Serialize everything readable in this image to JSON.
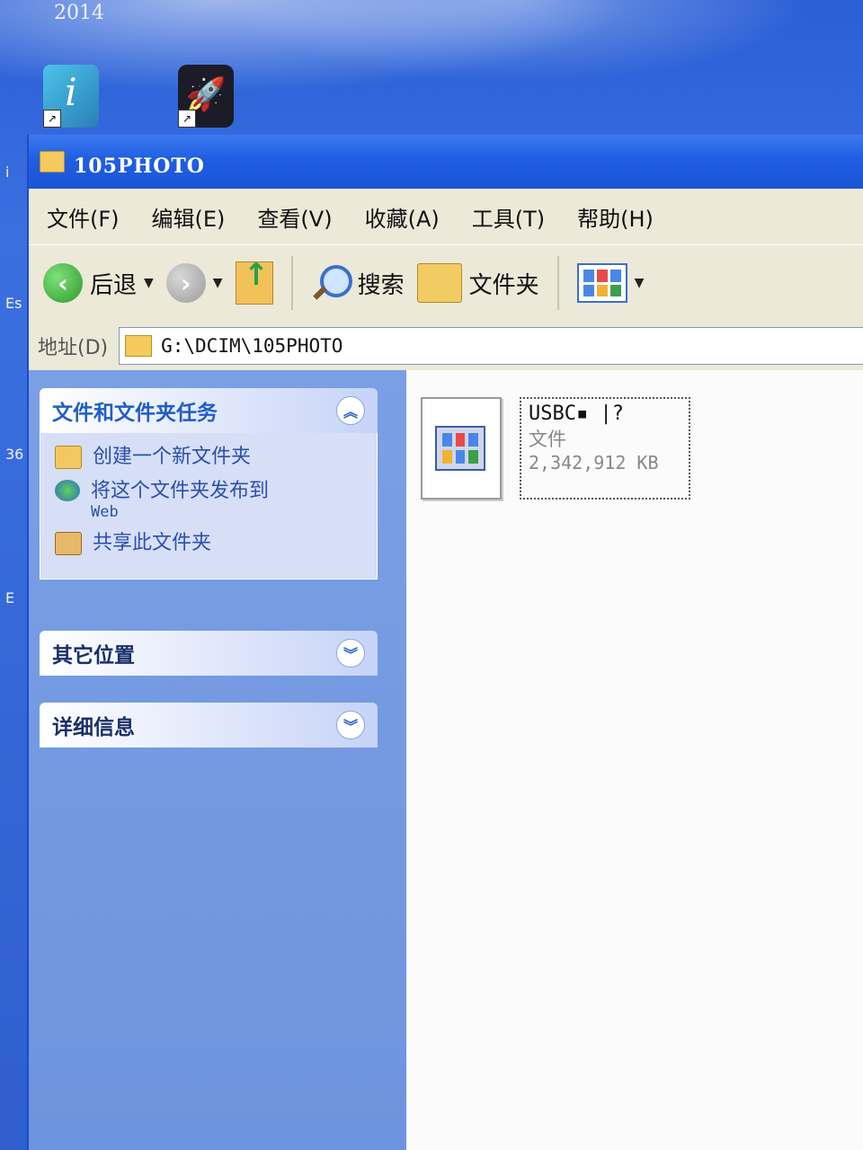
{
  "desktop": {
    "year": "2014",
    "edge_letters": [
      "i",
      "Es",
      "36",
      "E"
    ]
  },
  "window": {
    "title": "105PHOTO",
    "menu": [
      "文件(F)",
      "编辑(E)",
      "查看(V)",
      "收藏(A)",
      "工具(T)",
      "帮助(H)"
    ],
    "toolbar": {
      "back_label": "后退",
      "search_label": "搜索",
      "folders_label": "文件夹"
    },
    "address": {
      "label": "地址(D)",
      "path": "G:\\DCIM\\105PHOTO"
    }
  },
  "taskpane": {
    "file_tasks": {
      "title": "文件和文件夹任务",
      "items": [
        {
          "label": "创建一个新文件夹",
          "sub": ""
        },
        {
          "label": "将这个文件夹发布到",
          "sub": "Web"
        },
        {
          "label": "共享此文件夹",
          "sub": ""
        }
      ]
    },
    "other_places": {
      "title": "其它位置"
    },
    "details": {
      "title": "详细信息"
    }
  },
  "files": [
    {
      "name": "USBC▪ |?",
      "type": "文件",
      "size": "2,342,912 KB"
    }
  ]
}
